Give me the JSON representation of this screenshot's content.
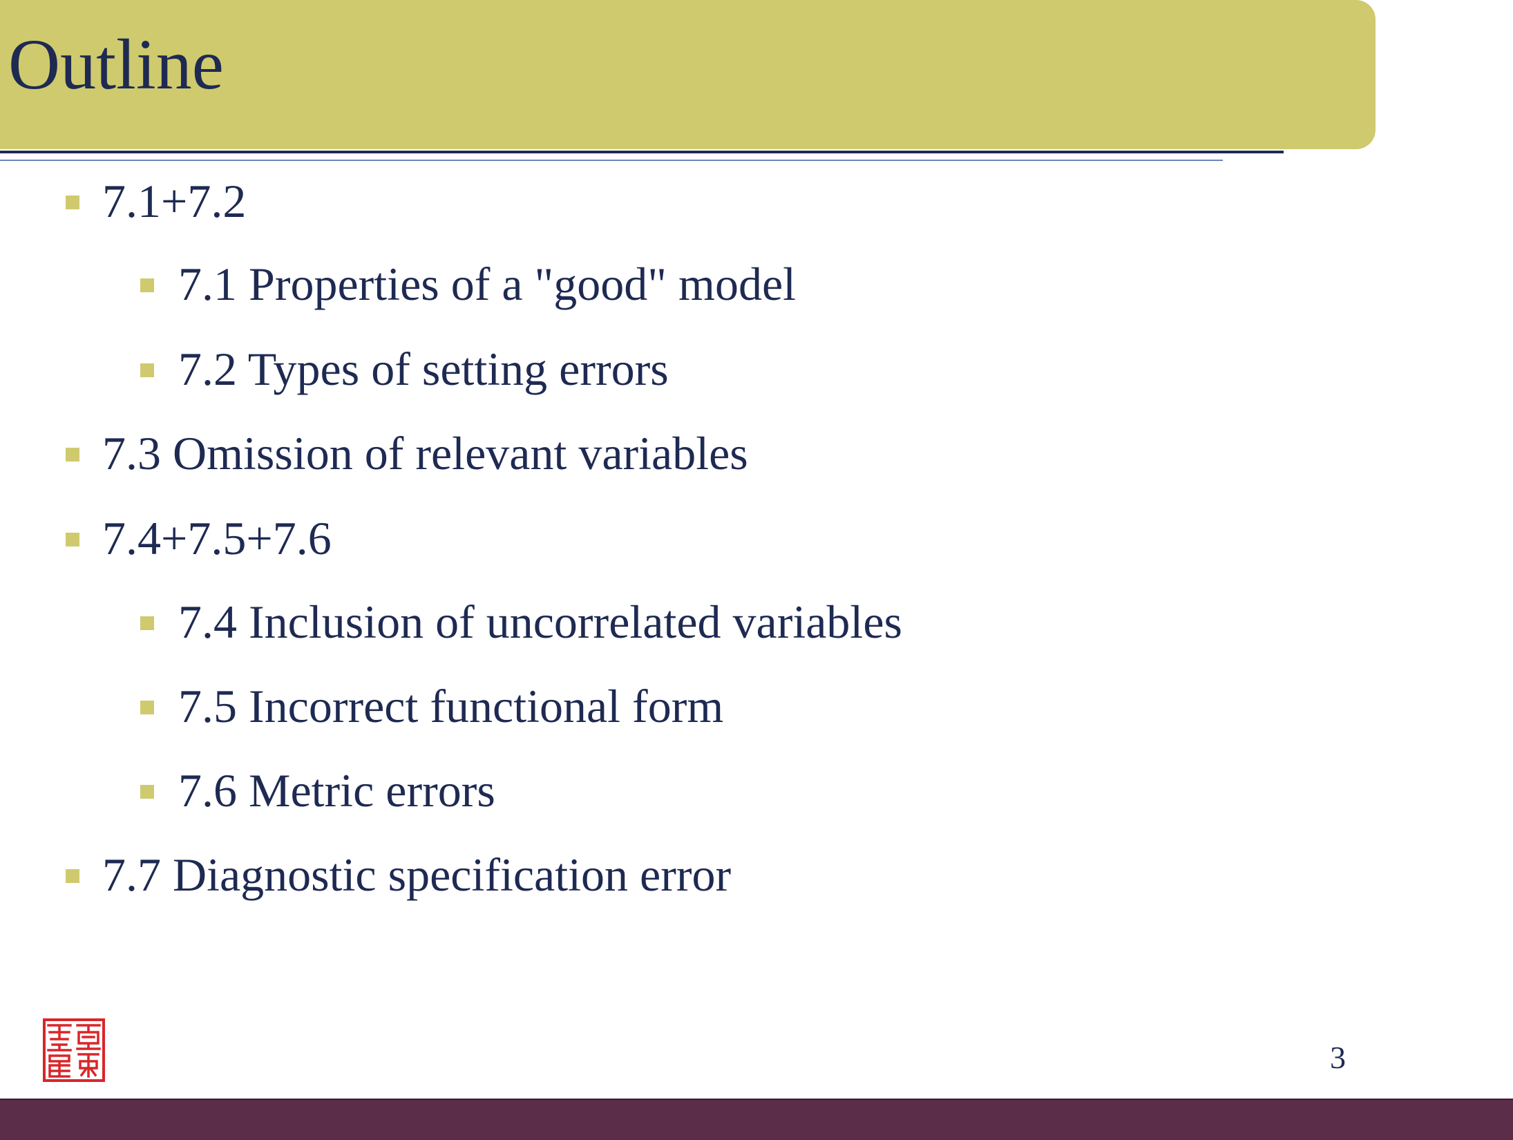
{
  "slide": {
    "title": "Outline",
    "page_number": "3",
    "colors": {
      "title_band": "#cfca6e",
      "text": "#1e2a52",
      "bullet": "#cfca6e",
      "footer_bar": "#5b2d48",
      "seal": "#d8262a"
    }
  },
  "outline": [
    {
      "level": 1,
      "text": "7.1+7.2"
    },
    {
      "level": 2,
      "text": "7.1 Properties of a \"good\" model"
    },
    {
      "level": 2,
      "text": "7.2 Types of setting errors"
    },
    {
      "level": 1,
      "text": "7.3 Omission of relevant variables"
    },
    {
      "level": 1,
      "text": "7.4+7.5+7.6"
    },
    {
      "level": 2,
      "text": "7.4 Inclusion of uncorrelated variables"
    },
    {
      "level": 2,
      "text": "7.5 Incorrect functional form"
    },
    {
      "level": 2,
      "text": "7.6 Metric errors"
    },
    {
      "level": 1,
      "text": "7.7 Diagnostic specification error"
    }
  ],
  "icons": {
    "seal": "red-chinese-seal-icon",
    "bullet": "square-bullet-icon"
  }
}
